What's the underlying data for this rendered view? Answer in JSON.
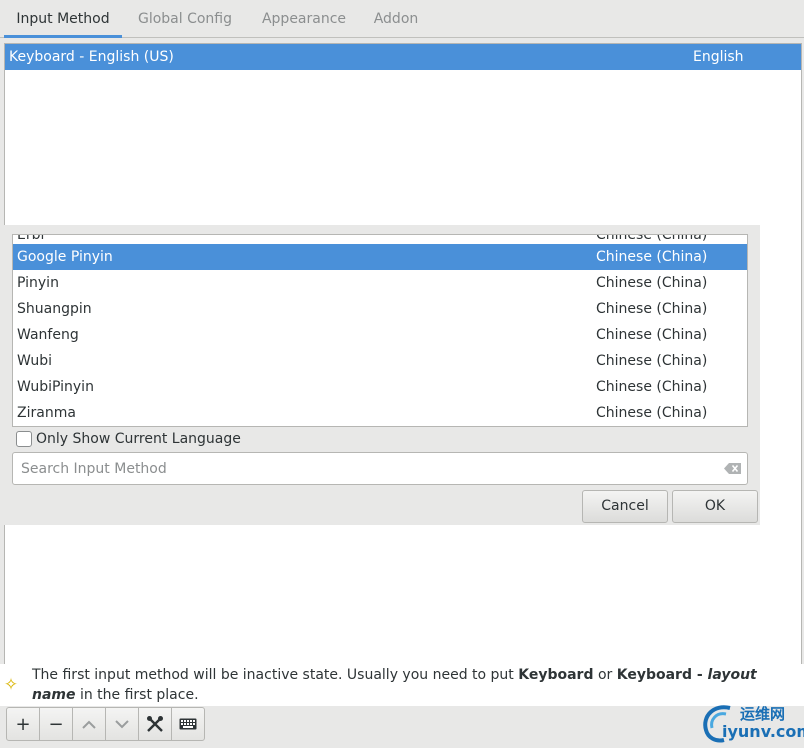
{
  "tabs": [
    {
      "label": "Input Method",
      "active": true
    },
    {
      "label": "Global Config",
      "active": false
    },
    {
      "label": "Appearance",
      "active": false
    },
    {
      "label": "Addon",
      "active": false
    }
  ],
  "main_list": {
    "rows": [
      {
        "name": "Keyboard - English (US)",
        "language": "English",
        "selected": true
      }
    ]
  },
  "dialog": {
    "partial_row": {
      "name": "Erbi",
      "language": "Chinese (China)"
    },
    "rows": [
      {
        "name": "Google Pinyin",
        "language": "Chinese (China)",
        "selected": true
      },
      {
        "name": "Pinyin",
        "language": "Chinese (China)",
        "selected": false
      },
      {
        "name": "Shuangpin",
        "language": "Chinese (China)",
        "selected": false
      },
      {
        "name": "Wanfeng",
        "language": "Chinese (China)",
        "selected": false
      },
      {
        "name": "Wubi",
        "language": "Chinese (China)",
        "selected": false
      },
      {
        "name": "WubiPinyin",
        "language": "Chinese (China)",
        "selected": false
      },
      {
        "name": "Ziranma",
        "language": "Chinese (China)",
        "selected": false
      }
    ],
    "only_current_language_label": "Only Show Current Language",
    "only_current_language_checked": false,
    "search_placeholder": "Search Input Method",
    "search_value": "",
    "cancel_label": "Cancel",
    "ok_label": "OK"
  },
  "hint": {
    "part1": "The first input method will be inactive state. Usually you need to put ",
    "keyboard": "Keyboard",
    "or": " or ",
    "keyboard_layout": "Keyboard - ",
    "layout_name": "layout name",
    "part2": " in the first place."
  },
  "toolbar": {
    "add": "+",
    "remove": "−",
    "up": "chevron-up-icon",
    "down": "chevron-down-icon",
    "configure": "tools-icon",
    "keyboard": "keyboard-icon"
  },
  "watermark": {
    "cn": "运维网",
    "en": "iyunv.com"
  },
  "colors": {
    "selection": "#4a90d9",
    "hint_icon": "#d9b400",
    "watermark": "#1a6fb5"
  }
}
